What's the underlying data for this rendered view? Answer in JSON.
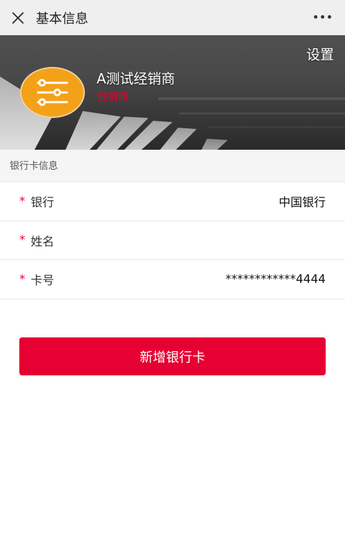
{
  "titlebar": {
    "title": "基本信息",
    "close_icon": "close-icon",
    "more_icon": "more-dots-icon"
  },
  "profile": {
    "settings_label": "设置",
    "name": "A测试经销商",
    "role": "经销商",
    "avatar_icon": "sliders-icon",
    "avatar_color": "#f4a11a"
  },
  "bank_section": {
    "header": "银行卡信息",
    "required_mark": "*",
    "rows": [
      {
        "label": "银行",
        "value": "中国银行"
      },
      {
        "label": "姓名",
        "value": ""
      },
      {
        "label": "卡号",
        "value": "************4444"
      }
    ]
  },
  "actions": {
    "add_card_label": "新增银行卡",
    "accent_color": "#e60033"
  }
}
